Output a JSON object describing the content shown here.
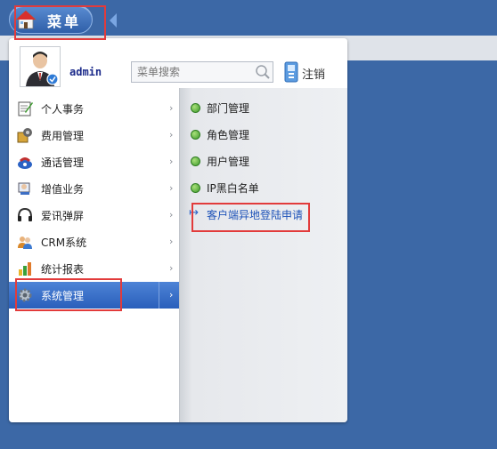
{
  "header": {
    "menu_label": "菜单"
  },
  "panel": {
    "username": "admin",
    "search_placeholder": "菜单搜索",
    "logout_label": "注销"
  },
  "menu": {
    "items": [
      {
        "label": "个人事务",
        "icon": "notepad-icon"
      },
      {
        "label": "费用管理",
        "icon": "fee-icon"
      },
      {
        "label": "通话管理",
        "icon": "phone-icon"
      },
      {
        "label": "增值业务",
        "icon": "value-added-icon"
      },
      {
        "label": "爱讯弹屏",
        "icon": "headset-icon"
      },
      {
        "label": "CRM系统",
        "icon": "users-icon"
      },
      {
        "label": "统计报表",
        "icon": "bar-chart-icon"
      },
      {
        "label": "系统管理",
        "icon": "gear-icon",
        "active": true
      }
    ],
    "chevron": "›"
  },
  "submenu": {
    "items": [
      {
        "label": "部门管理"
      },
      {
        "label": "角色管理"
      },
      {
        "label": "用户管理"
      },
      {
        "label": "IP黑白名单"
      },
      {
        "label": "客户端异地登陆申请",
        "selected": true
      }
    ],
    "selected_arrow": "↦"
  },
  "colors": {
    "background": "#3c68a6",
    "active_item": "#2a5fbb",
    "highlight_box": "#e23b3b"
  }
}
